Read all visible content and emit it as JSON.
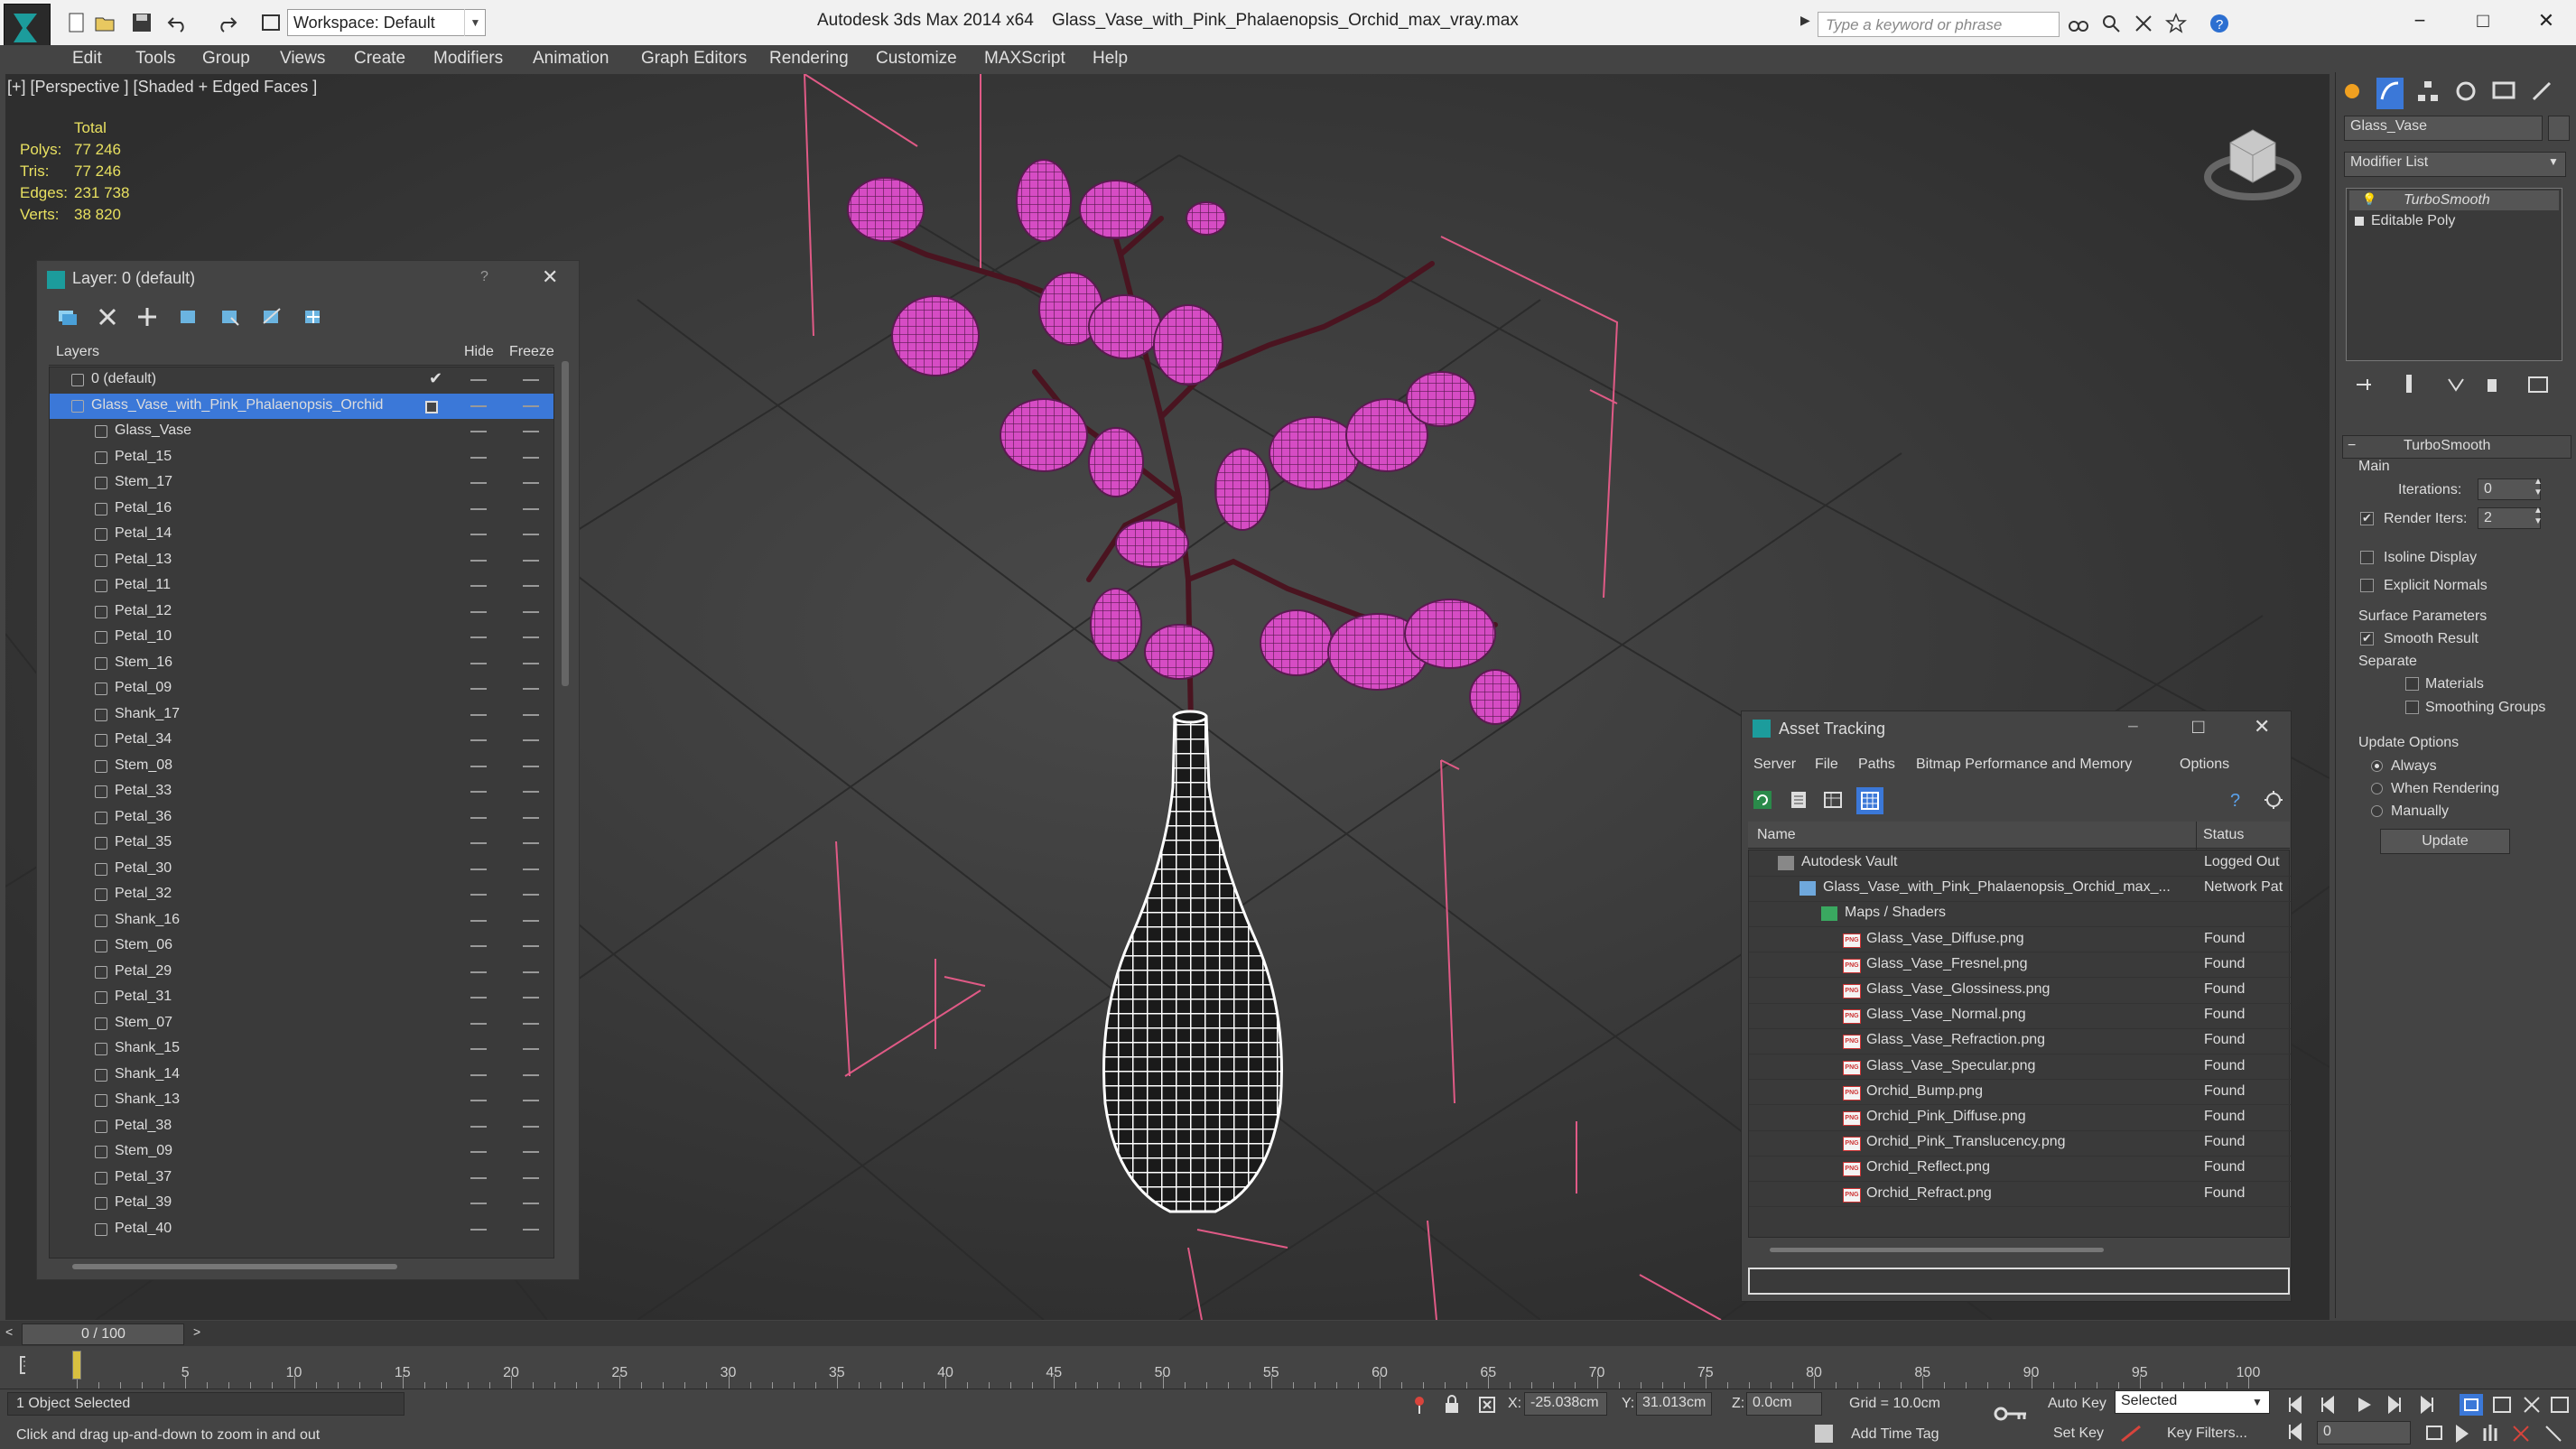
{
  "titlebar": {
    "workspace": "Workspace: Default",
    "app_title": "Autodesk 3ds Max  2014 x64",
    "file_title": "Glass_Vase_with_Pink_Phalaenopsis_Orchid_max_vray.max",
    "search_placeholder": "Type a keyword or phrase"
  },
  "menu": [
    "Edit",
    "Tools",
    "Group",
    "Views",
    "Create",
    "Modifiers",
    "Animation",
    "Graph Editors",
    "Rendering",
    "Customize",
    "MAXScript",
    "Help"
  ],
  "viewport": {
    "label": "[+] [Perspective ] [Shaded + Edged Faces ]",
    "stats_header": "Total",
    "stats": [
      {
        "label": "Polys:",
        "value": "77 246"
      },
      {
        "label": "Tris:",
        "value": "77 246"
      },
      {
        "label": "Edges:",
        "value": "231 738"
      },
      {
        "label": "Verts:",
        "value": "38 820"
      }
    ]
  },
  "layer_panel": {
    "title": "Layer: 0 (default)",
    "help": "?",
    "col_layers": "Layers",
    "col_hide": "Hide",
    "col_freeze": "Freeze",
    "rows": [
      {
        "name": "0 (default)",
        "level": 1
      },
      {
        "name": "Glass_Vase_with_Pink_Phalaenopsis_Orchid",
        "level": 1,
        "selected": true
      },
      {
        "name": "Glass_Vase",
        "level": 2
      },
      {
        "name": "Petal_15",
        "level": 2
      },
      {
        "name": "Stem_17",
        "level": 2
      },
      {
        "name": "Petal_16",
        "level": 2
      },
      {
        "name": "Petal_14",
        "level": 2
      },
      {
        "name": "Petal_13",
        "level": 2
      },
      {
        "name": "Petal_11",
        "level": 2
      },
      {
        "name": "Petal_12",
        "level": 2
      },
      {
        "name": "Petal_10",
        "level": 2
      },
      {
        "name": "Stem_16",
        "level": 2
      },
      {
        "name": "Petal_09",
        "level": 2
      },
      {
        "name": "Shank_17",
        "level": 2
      },
      {
        "name": "Petal_34",
        "level": 2
      },
      {
        "name": "Stem_08",
        "level": 2
      },
      {
        "name": "Petal_33",
        "level": 2
      },
      {
        "name": "Petal_36",
        "level": 2
      },
      {
        "name": "Petal_35",
        "level": 2
      },
      {
        "name": "Petal_30",
        "level": 2
      },
      {
        "name": "Petal_32",
        "level": 2
      },
      {
        "name": "Shank_16",
        "level": 2
      },
      {
        "name": "Stem_06",
        "level": 2
      },
      {
        "name": "Petal_29",
        "level": 2
      },
      {
        "name": "Petal_31",
        "level": 2
      },
      {
        "name": "Stem_07",
        "level": 2
      },
      {
        "name": "Shank_15",
        "level": 2
      },
      {
        "name": "Shank_14",
        "level": 2
      },
      {
        "name": "Shank_13",
        "level": 2
      },
      {
        "name": "Petal_38",
        "level": 2
      },
      {
        "name": "Stem_09",
        "level": 2
      },
      {
        "name": "Petal_37",
        "level": 2
      },
      {
        "name": "Petal_39",
        "level": 2
      },
      {
        "name": "Petal_40",
        "level": 2
      }
    ]
  },
  "asset_panel": {
    "title": "Asset Tracking",
    "menu": [
      "Server",
      "File",
      "Paths",
      "Bitmap Performance and Memory",
      "Options"
    ],
    "col_name": "Name",
    "col_status": "Status",
    "rows": [
      {
        "name": "Autodesk Vault",
        "status": "Logged Out",
        "indent": 1,
        "kind": "vault"
      },
      {
        "name": "Glass_Vase_with_Pink_Phalaenopsis_Orchid_max_...",
        "status": "Network Pat",
        "indent": 2,
        "kind": "file"
      },
      {
        "name": "Maps / Shaders",
        "status": "",
        "indent": 3,
        "kind": "maps"
      },
      {
        "name": "Glass_Vase_Diffuse.png",
        "status": "Found",
        "indent": 4,
        "kind": "png"
      },
      {
        "name": "Glass_Vase_Fresnel.png",
        "status": "Found",
        "indent": 4,
        "kind": "png"
      },
      {
        "name": "Glass_Vase_Glossiness.png",
        "status": "Found",
        "indent": 4,
        "kind": "png"
      },
      {
        "name": "Glass_Vase_Normal.png",
        "status": "Found",
        "indent": 4,
        "kind": "png"
      },
      {
        "name": "Glass_Vase_Refraction.png",
        "status": "Found",
        "indent": 4,
        "kind": "png"
      },
      {
        "name": "Glass_Vase_Specular.png",
        "status": "Found",
        "indent": 4,
        "kind": "png"
      },
      {
        "name": "Orchid_Bump.png",
        "status": "Found",
        "indent": 4,
        "kind": "png"
      },
      {
        "name": "Orchid_Pink_Diffuse.png",
        "status": "Found",
        "indent": 4,
        "kind": "png"
      },
      {
        "name": "Orchid_Pink_Translucency.png",
        "status": "Found",
        "indent": 4,
        "kind": "png"
      },
      {
        "name": "Orchid_Reflect.png",
        "status": "Found",
        "indent": 4,
        "kind": "png"
      },
      {
        "name": "Orchid_Refract.png",
        "status": "Found",
        "indent": 4,
        "kind": "png"
      }
    ],
    "png_badge": "PNG"
  },
  "command_panel": {
    "object_name": "Glass_Vase",
    "modifier_list": "Modifier List",
    "stack": [
      "TurboSmooth",
      "Editable Poly"
    ],
    "rollout_title": "TurboSmooth",
    "main_label": "Main",
    "iterations_label": "Iterations:",
    "iterations_value": "0",
    "render_iters_label": "Render Iters:",
    "render_iters_value": "2",
    "isoline": "Isoline Display",
    "explicit_normals": "Explicit Normals",
    "surface_params": "Surface Parameters",
    "smooth_result": "Smooth Result",
    "separate": "Separate",
    "materials": "Materials",
    "smoothing_groups": "Smoothing Groups",
    "update_options": "Update Options",
    "always": "Always",
    "when_rendering": "When Rendering",
    "manually": "Manually",
    "update_button": "Update"
  },
  "timeline": {
    "frame_counter": "0 / 100",
    "ticks": [
      "5",
      "10",
      "15",
      "20",
      "25",
      "30",
      "35",
      "40",
      "45",
      "50",
      "55",
      "60",
      "65",
      "70",
      "75",
      "80",
      "85",
      "90",
      "95",
      "100"
    ]
  },
  "status": {
    "selection": "1 Object Selected",
    "prompt": "Click and drag up-and-down to zoom in and out",
    "x_label": "X:",
    "x_value": "-25.038cm",
    "y_label": "Y:",
    "y_value": "31.013cm",
    "z_label": "Z:",
    "z_value": "0.0cm",
    "grid": "Grid = 10.0cm",
    "auto_key": "Auto Key",
    "selected_dropdown": "Selected",
    "set_key": "Set Key",
    "key_filters": "Key Filters...",
    "add_time_tag": "Add Time Tag",
    "frame_value": "0"
  },
  "colors": {
    "orchid": "#d040c0",
    "bounding": "#e05a86",
    "selection": "#3b78d8"
  }
}
